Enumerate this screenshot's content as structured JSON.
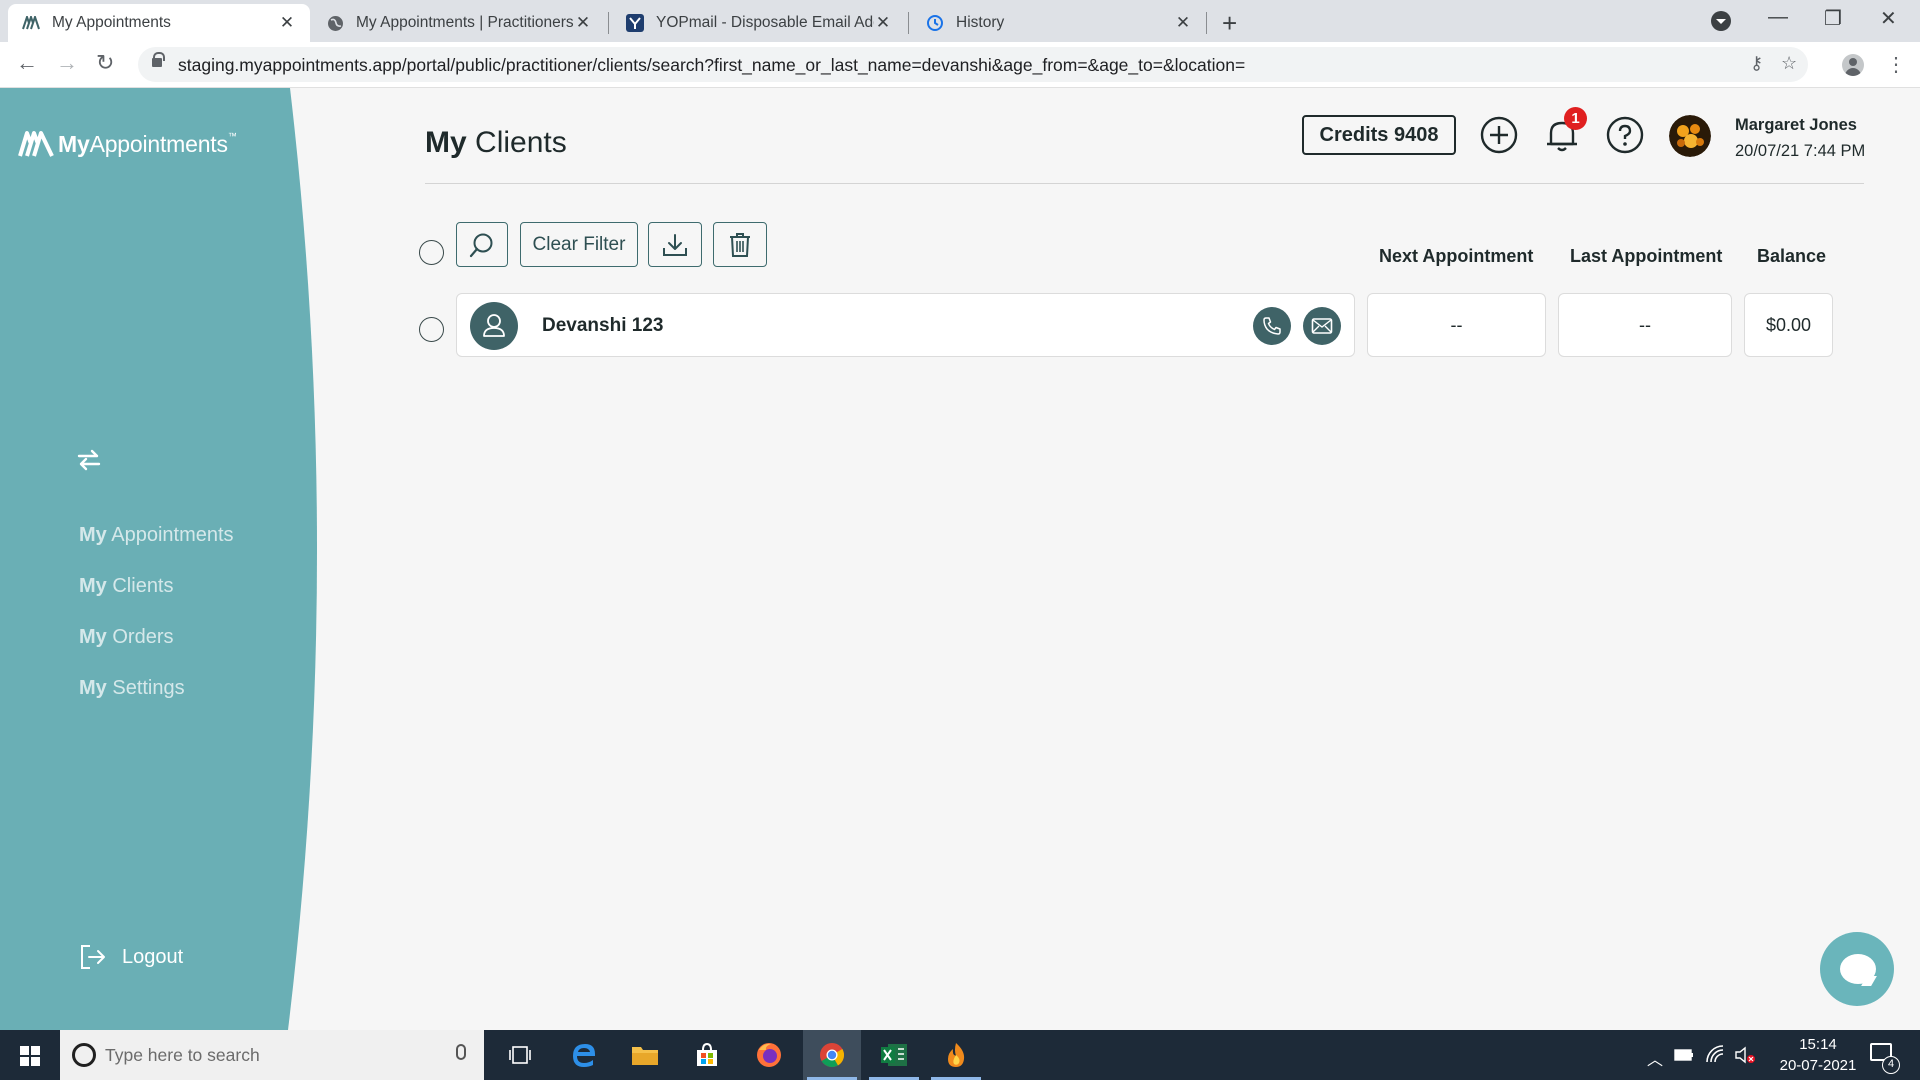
{
  "browser": {
    "tabs": [
      {
        "title": "My Appointments",
        "icon": "myappointments-favicon",
        "active": true
      },
      {
        "title": "My Appointments | Practitioners",
        "icon": "globe-favicon",
        "active": false
      },
      {
        "title": "YOPmail - Disposable Email Addr",
        "icon": "yopmail-favicon",
        "active": false
      },
      {
        "title": "History",
        "icon": "history-favicon",
        "active": false
      }
    ],
    "url": "staging.myappointments.app/portal/public/practitioner/clients/search?first_name_or_last_name=devanshi&age_from=&age_to=&location="
  },
  "sidebar": {
    "bg_color": "#6aafb5",
    "logo": {
      "bold": "My",
      "light": "Appointments",
      "tm": "™"
    },
    "nav": [
      {
        "bold": "My",
        "light": "Appointments"
      },
      {
        "bold": "My",
        "light": "Clients"
      },
      {
        "bold": "My",
        "light": "Orders"
      },
      {
        "bold": "My",
        "light": "Settings"
      }
    ],
    "logout_label": "Logout"
  },
  "header": {
    "title_bold": "My",
    "title_light": "Clients",
    "credits_label": "Credits 9408",
    "notification_count": "1",
    "user_name": "Margaret Jones",
    "user_datetime": "20/07/21 7:44 PM"
  },
  "filters": {
    "clear_filter_label": "Clear Filter"
  },
  "table": {
    "columns": [
      "Next Appointment",
      "Last Appointment",
      "Balance"
    ],
    "rows": [
      {
        "name": "Devanshi 123",
        "next_appointment": "--",
        "last_appointment": "--",
        "balance": "$0.00"
      }
    ]
  },
  "taskbar": {
    "search_placeholder": "Type here to search",
    "time": "15:14",
    "date": "20-07-2021",
    "notification_count": "4"
  },
  "colors": {
    "accent": "#6aafb5",
    "dark_teal": "#3f6367",
    "badge_red": "#e02020"
  }
}
